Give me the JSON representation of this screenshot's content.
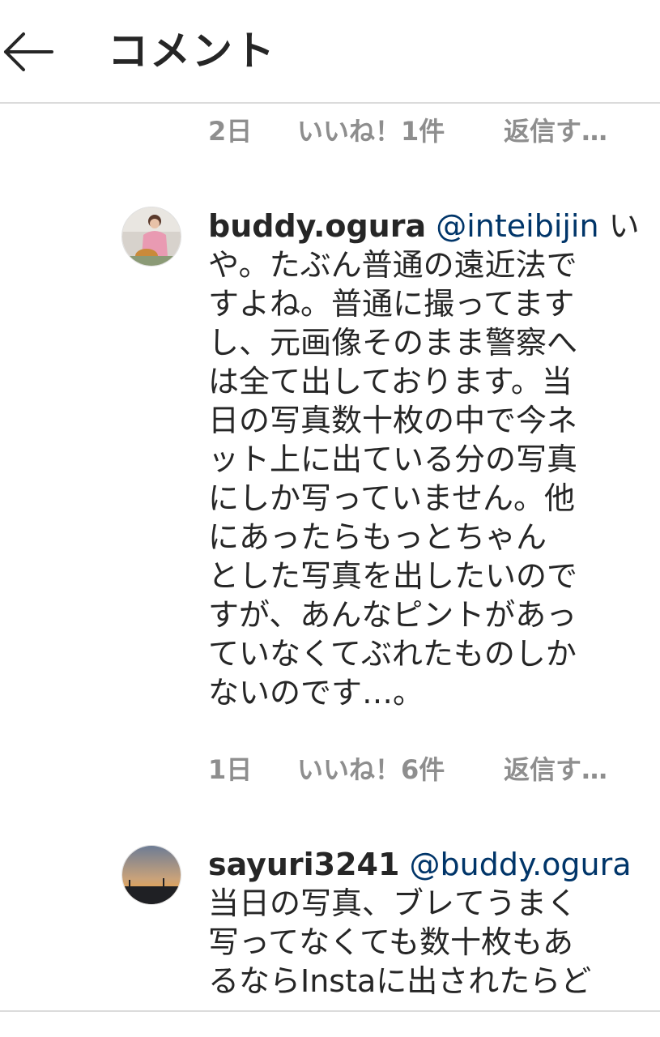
{
  "header": {
    "title": "コメント",
    "back_icon": "arrow-left-icon"
  },
  "comments": [
    {
      "time": "2日",
      "likes": "いいね！1件",
      "reply": "返信す…"
    },
    {
      "username": "buddy.ogura",
      "mention": "@inteibijin",
      "first_line_rest": "い",
      "lines": [
        "や。たぶん普通の遠近法で",
        "すよね。普通に撮ってます",
        "し、元画像そのまま警察へ",
        "は全て出しております。当",
        "日の写真数十枚の中で今ネ",
        "ット上に出ている分の写真",
        "にしか写っていません。他",
        "にあったらもっとちゃん",
        "とした写真を出したいので",
        "すが、あんなピントがあっ",
        "ていなくてぶれたものしか",
        "ないのです…。"
      ],
      "time": "1日",
      "likes": "いいね！6件",
      "reply": "返信す…"
    },
    {
      "username": "sayuri3241",
      "mention": "@buddy.ogura",
      "lines": [
        "当日の写真、ブレてうまく",
        "写ってなくても数十枚もあ",
        "るならInstaに出されたらど"
      ]
    }
  ],
  "colors": {
    "text": "#262626",
    "meta": "#8e8e8e",
    "mention": "#003569",
    "divider": "#dbdbdb"
  }
}
